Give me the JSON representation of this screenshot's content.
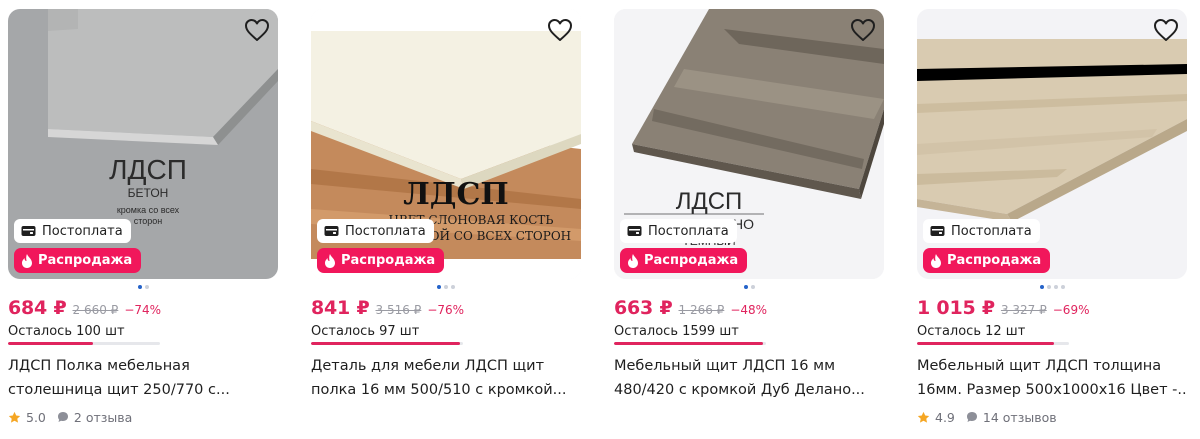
{
  "badges": {
    "postpay": "Постоплата",
    "sale": "Распродажа"
  },
  "stock_prefix": "Осталось",
  "colors": {
    "accent": "#e0245e",
    "sale_badge": "#f1175b",
    "star": "#f5a623"
  },
  "products": [
    {
      "image_text": {
        "title": "ЛДСП",
        "subtitle": "БЕТОН",
        "note_1": "кромка со всех",
        "note_2": "сторон"
      },
      "price": "684 ₽",
      "old_price": "2 660 ₽",
      "discount": "−74%",
      "stock": "Осталось 100 шт",
      "stock_fraction": 0.56,
      "title_line1": "ЛДСП Полка мебельная",
      "title_line2": "столешница щит 250/770 с...",
      "rating": "5.0",
      "reviews": "2 отзыва",
      "dots_active": 1,
      "dots_total": 2
    },
    {
      "image_text": {
        "title": "ЛДСП",
        "line_1": "ЦВЕТ СЛОНОВАЯ КОСТЬ",
        "line_2": "КРОМКОЙ СО ВСЕХ СТОРОН"
      },
      "price": "841 ₽",
      "old_price": "3 516 ₽",
      "discount": "−76%",
      "stock": "Осталось 97 шт",
      "stock_fraction": 0.98,
      "title_line1": "Деталь для мебели ЛДСП щит",
      "title_line2": "полка 16 мм 500/510 с кромкой...",
      "dots_active": 1,
      "dots_total": 3
    },
    {
      "image_text": {
        "title": "ЛДСП",
        "line_1": "ДУБ ДЕЛАНО",
        "line_2": "ТЕМНЫЙ"
      },
      "price": "663 ₽",
      "old_price": "1 266 ₽",
      "discount": "−48%",
      "stock": "Осталось 1599 шт",
      "stock_fraction": 0.98,
      "title_line1": "Мебельный щит ЛДСП 16 мм",
      "title_line2": "480/420 с кромкой Дуб Делано...",
      "dots_active": 1,
      "dots_total": 2
    },
    {
      "price": "1 015 ₽",
      "old_price": "3 327 ₽",
      "discount": "−69%",
      "stock": "Осталось 12 шт",
      "stock_fraction": 0.9,
      "title_line1": "Мебельный щит ЛДСП толщина",
      "title_line2": "16мм. Размер 500х1000х16 Цвет -...",
      "rating": "4.9",
      "reviews": "14 отзывов",
      "dots_active": 1,
      "dots_total": 4
    }
  ]
}
